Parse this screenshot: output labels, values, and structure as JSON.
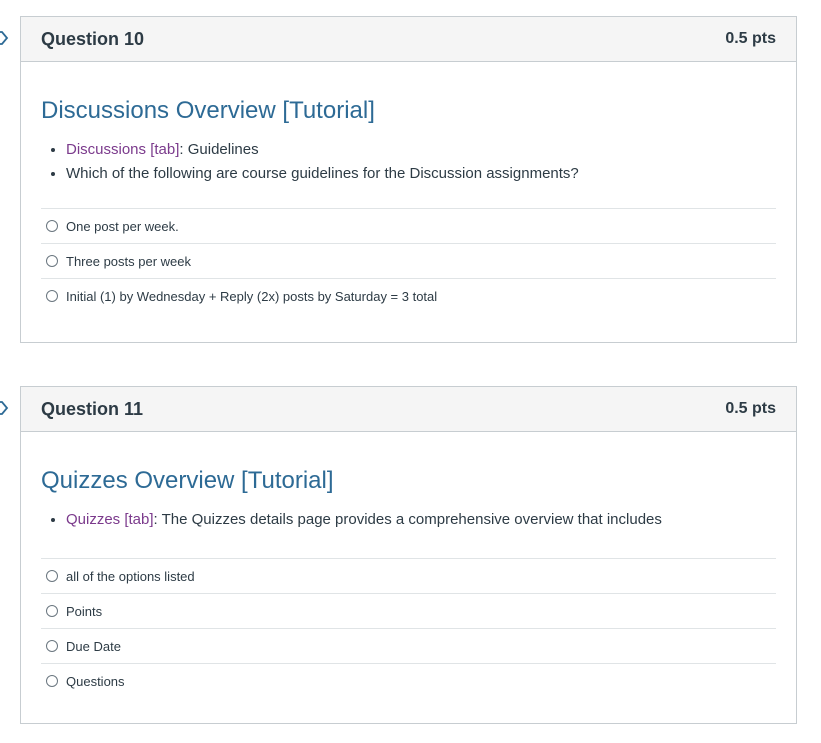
{
  "questions": [
    {
      "title": "Question 10",
      "points": "0.5 pts",
      "heading": "Discussions Overview [Tutorial]",
      "bullets": [
        {
          "link": "Discussions [tab]",
          "text": ": Guidelines"
        },
        {
          "link": "",
          "text": "Which of the following are course guidelines for the Discussion assignments?"
        }
      ],
      "answers": [
        "One post per week.",
        "Three posts per week",
        "Initial (1) by Wednesday + Reply (2x) posts by Saturday = 3 total"
      ]
    },
    {
      "title": "Question 11",
      "points": "0.5 pts",
      "heading": "Quizzes Overview [Tutorial]",
      "bullets": [
        {
          "link": "Quizzes [tab]",
          "text": ": The Quizzes details page provides a comprehensive overview that includes"
        }
      ],
      "answers": [
        "all of the options listed",
        "Points",
        "Due Date",
        "Questions"
      ]
    }
  ],
  "colors": {
    "heading": "#2d6a95",
    "link": "#7b3a8c",
    "header_bg": "#f5f5f5",
    "border": "#c7cdd1"
  },
  "icons": {
    "flag": "flag-question-icon",
    "radio": "radio-button-icon"
  }
}
